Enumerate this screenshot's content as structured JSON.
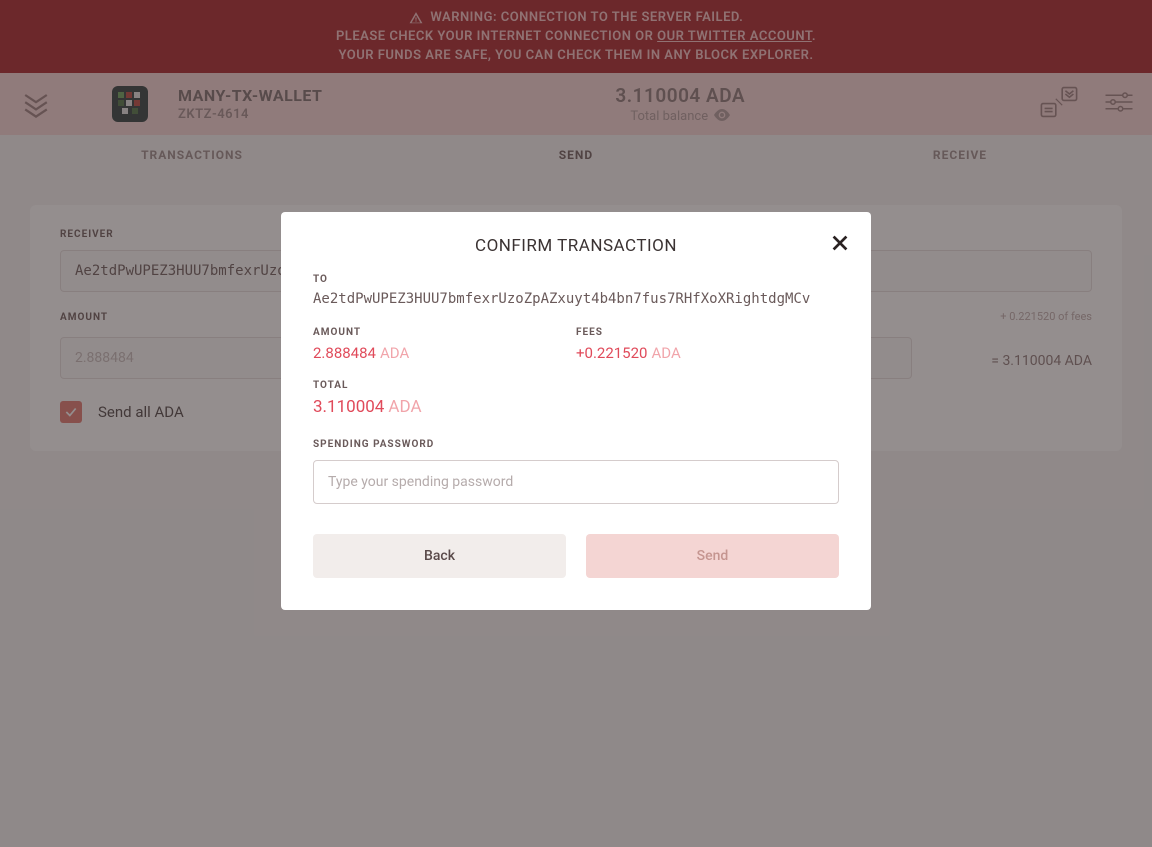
{
  "warning": {
    "line1": "WARNING: CONNECTION TO THE SERVER FAILED.",
    "line2_pre": "PLEASE CHECK YOUR INTERNET CONNECTION OR ",
    "line2_link": "OUR TWITTER ACCOUNT",
    "line2_post": ".",
    "line3": "YOUR FUNDS ARE SAFE, YOU CAN CHECK THEM IN ANY BLOCK EXPLORER."
  },
  "wallet": {
    "name": "MANY-TX-WALLET",
    "id": "ZKTZ-4614"
  },
  "balance": {
    "amount": "3.110004 ADA",
    "label": "Total balance"
  },
  "tabs": {
    "transactions": "TRANSACTIONS",
    "send": "SEND",
    "receive": "RECEIVE"
  },
  "form": {
    "receiver_label": "RECEIVER",
    "receiver_value": "Ae2tdPwUPEZ3HUU7bmfexrUzoZpAZxuyt4b4bn7fus7RHfXoXRightdgMCv",
    "amount_label": "AMOUNT",
    "amount_value": "2.888484",
    "fees_text": "+ 0.221520 of fees",
    "total_text": "= 3.110004 ADA",
    "send_all_label": "Send all ADA"
  },
  "modal": {
    "title": "CONFIRM TRANSACTION",
    "to_label": "TO",
    "to_value": "Ae2tdPwUPEZ3HUU7bmfexrUzoZpAZxuyt4b4bn7fus7RHfXoXRightdgMCv",
    "amount_label": "AMOUNT",
    "amount_value": "2.888484",
    "amount_currency": "ADA",
    "fees_label": "FEES",
    "fees_value": "+0.221520",
    "fees_currency": "ADA",
    "total_label": "TOTAL",
    "total_value": "3.110004",
    "total_currency": "ADA",
    "password_label": "SPENDING PASSWORD",
    "password_placeholder": "Type your spending password",
    "back_label": "Back",
    "send_label": "Send"
  }
}
